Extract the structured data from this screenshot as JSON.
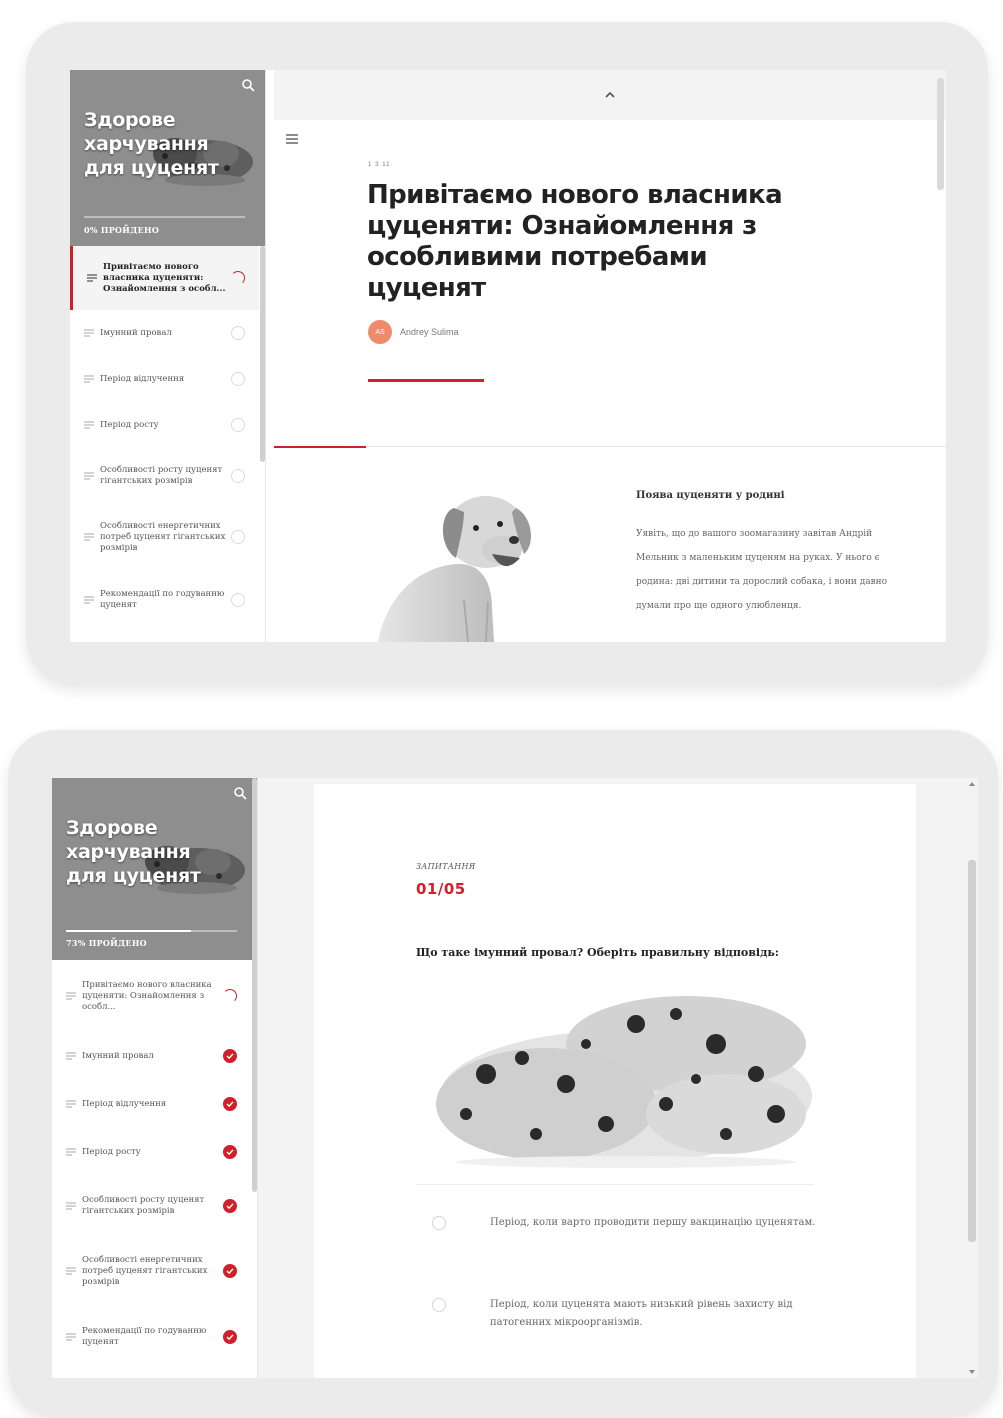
{
  "course": {
    "title": "Здорове харчування для цуценят"
  },
  "screen1": {
    "progress_label": "0% ПРОЙДЕНО",
    "progress_fraction": 0.0,
    "menu": [
      {
        "label": "Привітаємо нового власника цуценяти: Ознайомлення з особл...",
        "status": "loading",
        "active": true
      },
      {
        "label": "Імунний провал",
        "status": "todo",
        "active": false
      },
      {
        "label": "Період відлучення",
        "status": "todo",
        "active": false
      },
      {
        "label": "Період росту",
        "status": "todo",
        "active": false
      },
      {
        "label": "Особливості росту цуценят гігантських розмірів",
        "status": "todo",
        "active": false
      },
      {
        "label": "Особливості енергетичних потреб цуценят гігантських розмірів",
        "status": "todo",
        "active": false
      },
      {
        "label": "Рекомендації по годуванню цуценят",
        "status": "todo",
        "active": false
      }
    ],
    "lesson_number": "1 З 11",
    "lesson_title": "Привітаємо нового власника цуценяти: Ознайомлення з особливими потребами цуценят",
    "author_initials": "AS",
    "author_name": "Andrey Sulima",
    "card_title": "Поява цуценяти у родині",
    "card_text": "Уявіть, що до вашого зоомагазину завітав Андрій Мельник з маленьким цуценям на руках. У нього є родина: дві дитини та дорослий собака, і вони давно думали про ще одного улюбленця."
  },
  "screen2": {
    "progress_label": "73% ПРОЙДЕНО",
    "progress_fraction": 0.73,
    "menu": [
      {
        "label": "Привітаємо нового власника цуценяти: Ознайомлення з особл...",
        "status": "loading",
        "active": false
      },
      {
        "label": "Імунний провал",
        "status": "done",
        "active": false
      },
      {
        "label": "Період відлучення",
        "status": "done",
        "active": false
      },
      {
        "label": "Період росту",
        "status": "done",
        "active": false
      },
      {
        "label": "Особливості росту цуценят гігантських розмірів",
        "status": "done",
        "active": false
      },
      {
        "label": "Особливості енергетичних потреб цуценят гігантських розмірів",
        "status": "done",
        "active": false
      },
      {
        "label": "Рекомендації по годуванню цуценят",
        "status": "done",
        "active": false
      }
    ],
    "quiz_label": "ЗАПИТАННЯ",
    "quiz_count": "01/05",
    "question": "Що таке імунний провал? Оберіть правильну відповідь:",
    "answers": [
      "Період, коли варто проводити першу вакцинацію цуценятам.",
      "Період, коли цуценята мають низький рівень захисту від патогенних мікроорганізмів."
    ]
  },
  "colors": {
    "accent": "#d0202a",
    "sidebar_header": "#8e8e8e",
    "tablet_frame": "#ebebeb"
  },
  "icons": [
    "search-icon",
    "chevron-up-icon",
    "hamburger-menu-icon",
    "lesson-lines-icon",
    "check-icon",
    "loading-spinner-icon"
  ]
}
